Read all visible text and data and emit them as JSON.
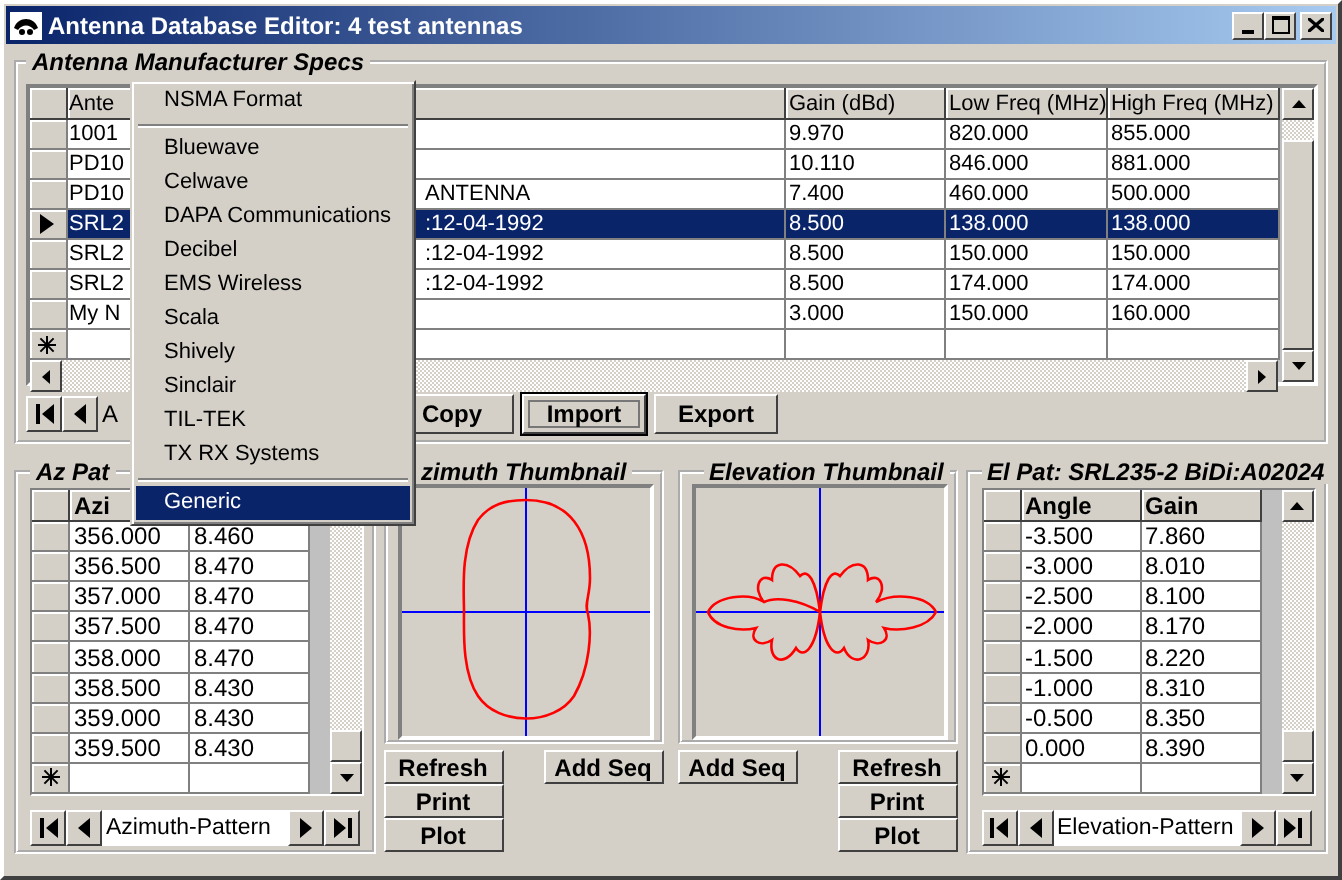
{
  "window": {
    "title": "Antenna Database Editor: 4 test antennas"
  },
  "specs": {
    "title": "Antenna Manufacturer Specs",
    "columns": {
      "name": "Ante",
      "gain": "Gain (dBd)",
      "low_freq": "Low Freq (MHz)",
      "high_freq": "High Freq (MHz)"
    },
    "rows": [
      {
        "name": "1001",
        "gain": "9.970",
        "low_freq": "820.000",
        "high_freq": "855.000",
        "selected": false
      },
      {
        "name": "PD10",
        "gain": "10.110",
        "low_freq": "846.000",
        "high_freq": "881.000",
        "selected": false
      },
      {
        "name": "PD10",
        "column_2": "ANTENNA",
        "gain": "7.400",
        "low_freq": "460.000",
        "high_freq": "500.000",
        "selected": false
      },
      {
        "name": "SRL2",
        "column_2": ":12-04-1992",
        "gain": "8.500",
        "low_freq": "138.000",
        "high_freq": "138.000",
        "selected": true
      },
      {
        "name": "SRL2",
        "column_2": ":12-04-1992",
        "gain": "8.500",
        "low_freq": "150.000",
        "high_freq": "150.000",
        "selected": false
      },
      {
        "name": "SRL2",
        "column_2": ":12-04-1992",
        "gain": "8.500",
        "low_freq": "174.000",
        "high_freq": "174.000",
        "selected": false
      },
      {
        "name": "My N",
        "gain": "3.000",
        "low_freq": "150.000",
        "high_freq": "160.000",
        "selected": false
      }
    ],
    "nav": "A",
    "buttons": [
      {
        "label": "Copy",
        "focused": false
      },
      {
        "label": "Import",
        "focused": true
      },
      {
        "label": "Export",
        "focused": false
      }
    ]
  },
  "menu": [
    {
      "kind": "item",
      "label": "NSMA Format",
      "selected": false
    },
    {
      "kind": "separator"
    },
    {
      "kind": "item",
      "label": "Bluewave",
      "selected": false
    },
    {
      "kind": "item",
      "label": "Celwave",
      "selected": false
    },
    {
      "kind": "item",
      "label": "DAPA Communications",
      "selected": false
    },
    {
      "kind": "item",
      "label": "Decibel",
      "selected": false
    },
    {
      "kind": "item",
      "label": "EMS Wireless",
      "selected": false
    },
    {
      "kind": "item",
      "label": "Scala",
      "selected": false
    },
    {
      "kind": "item",
      "label": "Shively",
      "selected": false
    },
    {
      "kind": "item",
      "label": "Sinclair",
      "selected": false
    },
    {
      "kind": "item",
      "label": "TIL-TEK",
      "selected": false
    },
    {
      "kind": "item",
      "label": "TX RX Systems",
      "selected": false
    },
    {
      "kind": "separator"
    },
    {
      "kind": "item",
      "label": "Generic",
      "selected": true
    }
  ],
  "az_pattern": {
    "title": "Az Pat",
    "columns": {
      "angle": "Azi"
    },
    "rows": [
      {
        "angle": "356.000",
        "gain": "8.460"
      },
      {
        "angle": "356.500",
        "gain": "8.470"
      },
      {
        "angle": "357.000",
        "gain": "8.470"
      },
      {
        "angle": "357.500",
        "gain": "8.470"
      },
      {
        "angle": "358.000",
        "gain": "8.470"
      },
      {
        "angle": "358.500",
        "gain": "8.430"
      },
      {
        "angle": "359.000",
        "gain": "8.430"
      },
      {
        "angle": "359.500",
        "gain": "8.430"
      }
    ],
    "nav": "Azimuth-Pattern"
  },
  "az_thumbnail": {
    "title": "zimuth Thumbnail",
    "buttons": [
      "Refresh",
      "Print",
      "Plot"
    ],
    "add_button": "Add Seq"
  },
  "el_thumbnail": {
    "title": "Elevation Thumbnail",
    "buttons": [
      "Refresh",
      "Print",
      "Plot"
    ],
    "add_button": "Add Seq"
  },
  "el_pattern": {
    "title": "El Pat: SRL235-2 BiDi:A02024",
    "columns": {
      "angle": "Angle",
      "gain": "Gain"
    },
    "rows": [
      {
        "angle": "-3.500",
        "gain": "7.860"
      },
      {
        "angle": "-3.000",
        "gain": "8.010"
      },
      {
        "angle": "-2.500",
        "gain": "8.100"
      },
      {
        "angle": "-2.000",
        "gain": "8.170"
      },
      {
        "angle": "-1.500",
        "gain": "8.220"
      },
      {
        "angle": "-1.000",
        "gain": "8.310"
      },
      {
        "angle": "-0.500",
        "gain": "8.350"
      },
      {
        "angle": "0.000",
        "gain": "8.390"
      }
    ],
    "nav": "Elevation-Pattern"
  }
}
